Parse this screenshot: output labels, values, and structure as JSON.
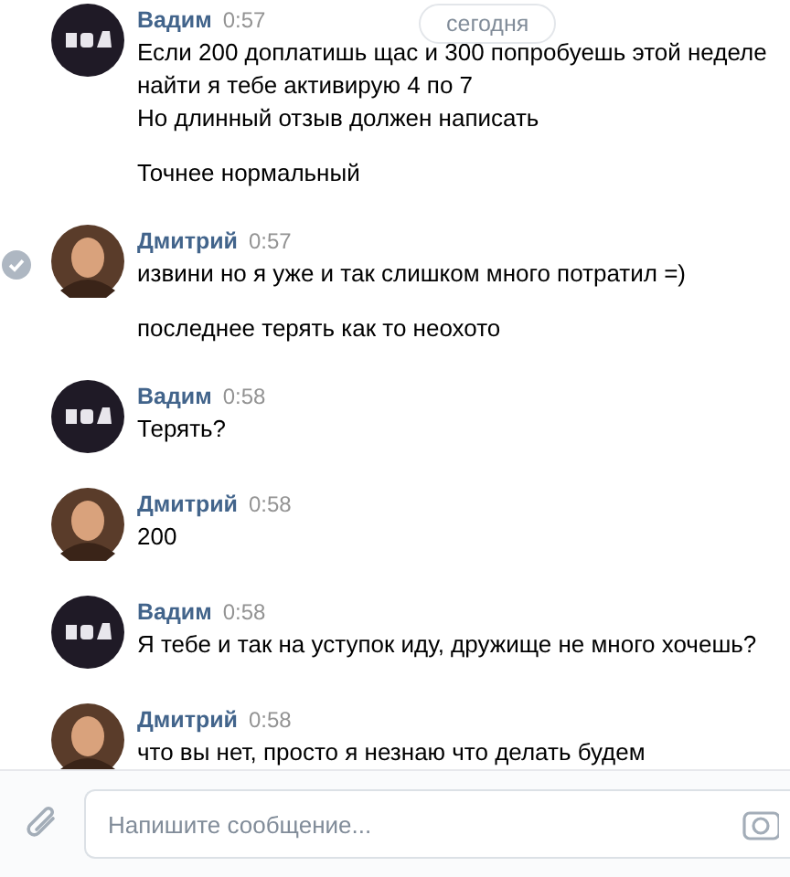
{
  "date_divider": "сегодня",
  "groups": [
    {
      "author": "Вадим",
      "kind": "logo",
      "time": "0:57",
      "hovered": false,
      "messages": [
        "Если 200 доплатишь щас и 300 попробуешь этой неделе найти я тебе активирую 4 по 7\nНо длинный отзыв должен написать",
        "Точнее нормальный"
      ]
    },
    {
      "author": "Дмитрий",
      "kind": "person",
      "time": "0:57",
      "hovered": true,
      "messages": [
        "извини но я уже и так слишком много потратил =)",
        "последнее терять как то неохото"
      ]
    },
    {
      "author": "Вадим",
      "kind": "logo",
      "time": "0:58",
      "hovered": false,
      "messages": [
        "Терять?"
      ]
    },
    {
      "author": "Дмитрий",
      "kind": "person",
      "time": "0:58",
      "hovered": false,
      "messages": [
        "200"
      ]
    },
    {
      "author": "Вадим",
      "kind": "logo",
      "time": "0:58",
      "hovered": false,
      "messages": [
        "Я тебе и так на уступок иду, дружище не много хочешь?"
      ]
    },
    {
      "author": "Дмитрий",
      "kind": "person",
      "time": "0:58",
      "hovered": false,
      "messages": [
        "что вы нет, просто я незнаю что делать будем"
      ]
    }
  ],
  "composer": {
    "placeholder": "Напишите сообщение..."
  }
}
